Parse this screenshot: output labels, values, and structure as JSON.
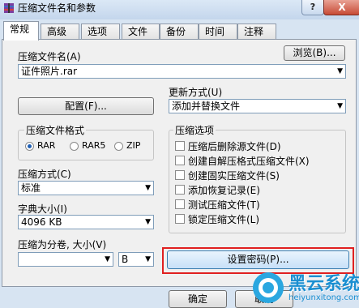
{
  "window": {
    "title": "压缩文件名和参数",
    "close_glyph": "X",
    "help_glyph": "?"
  },
  "tabs": [
    "常规",
    "高级",
    "选项",
    "文件",
    "备份",
    "时间",
    "注释"
  ],
  "general": {
    "archive_name_label": "压缩文件名(A)",
    "archive_name_value": "证件照片.rar",
    "browse_button": "浏览(B)...",
    "update_mode_label": "更新方式(U)",
    "update_mode_value": "添加并替换文件",
    "profiles_button": "配置(F)...",
    "format_group_label": "压缩文件格式",
    "formats": [
      "RAR",
      "RAR5",
      "ZIP"
    ],
    "selected_format": "RAR",
    "method_label": "压缩方式(C)",
    "method_value": "标准",
    "dictionary_label": "字典大小(I)",
    "dictionary_value": "4096 KB",
    "split_label": "压缩为分卷, 大小(V)",
    "split_value": "",
    "split_unit": "B",
    "options_group_label": "压缩选项",
    "options": [
      {
        "label": "压缩后删除源文件(D)",
        "checked": false
      },
      {
        "label": "创建自解压格式压缩文件(X)",
        "checked": false
      },
      {
        "label": "创建固实压缩文件(S)",
        "checked": false
      },
      {
        "label": "添加恢复记录(E)",
        "checked": false
      },
      {
        "label": "测试压缩文件(T)",
        "checked": false
      },
      {
        "label": "锁定压缩文件(L)",
        "checked": false
      }
    ],
    "set_password_button": "设置密码(P)..."
  },
  "footer": {
    "ok_button": "确定",
    "cancel_button": "取消"
  },
  "watermark": {
    "title": "黑云系统",
    "url": "heiyunxitong.com"
  },
  "colors": {
    "accent_blue": "#1e5fb4",
    "highlight_red": "#e02020"
  }
}
